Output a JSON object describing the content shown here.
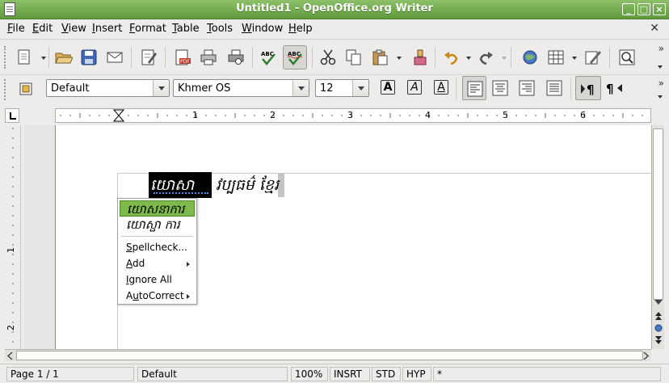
{
  "window": {
    "title": "Untitled1 - OpenOffice.org Writer"
  },
  "menubar": [
    {
      "label": "File",
      "mnemonic": "F",
      "rest": "ile"
    },
    {
      "label": "Edit",
      "mnemonic": "E",
      "rest": "dit"
    },
    {
      "label": "View",
      "mnemonic": "V",
      "rest": "iew"
    },
    {
      "label": "Insert",
      "mnemonic": "I",
      "rest": "nsert"
    },
    {
      "label": "Format",
      "mnemonic": "F",
      "rest": "ormat"
    },
    {
      "label": "Table",
      "mnemonic": "T",
      "rest": "able"
    },
    {
      "label": "Tools",
      "mnemonic": "T",
      "rest": "ools"
    },
    {
      "label": "Window",
      "mnemonic": "W",
      "rest": "indow"
    },
    {
      "label": "Help",
      "mnemonic": "H",
      "rest": "elp"
    }
  ],
  "formatting": {
    "paragraph_style": "Default",
    "font_name": "Khmer OS",
    "font_size": "12"
  },
  "ruler": {
    "horizontal_numbers": [
      "1",
      "2",
      "3",
      "4",
      "5",
      "6"
    ],
    "vertical_numbers": [
      "1",
      "2"
    ]
  },
  "document": {
    "selected_word": "យោសាការ",
    "rest_text": "វប្បធម៌ ខ្មែរ"
  },
  "context_menu": {
    "suggestions": [
      "យោសនាការ",
      "យោស្ផា ការ"
    ],
    "spellcheck": {
      "label": "Spellcheck...",
      "mnemonic": "S",
      "rest": "pellcheck..."
    },
    "add": {
      "label": "Add",
      "mnemonic": "A",
      "rest": "dd"
    },
    "ignore_all": {
      "label": "Ignore All",
      "mnemonic": "I",
      "rest": "gnore All"
    },
    "autocorrect": {
      "label": "AutoCorrect",
      "pre": "A",
      "mnemonic": "u",
      "rest": "toCorrect"
    }
  },
  "statusbar": {
    "page": "Page 1 / 1",
    "style": "Default",
    "zoom": "100%",
    "insert_mode": "INSRT",
    "selection_mode": "STD",
    "hyperlink_mode": "HYP",
    "modified": "*"
  },
  "colors": {
    "titlebar": "#5f9a3a",
    "menu_highlight": "#7dba4b",
    "selection": "#000000",
    "spell_underline": "#3b8df0"
  }
}
